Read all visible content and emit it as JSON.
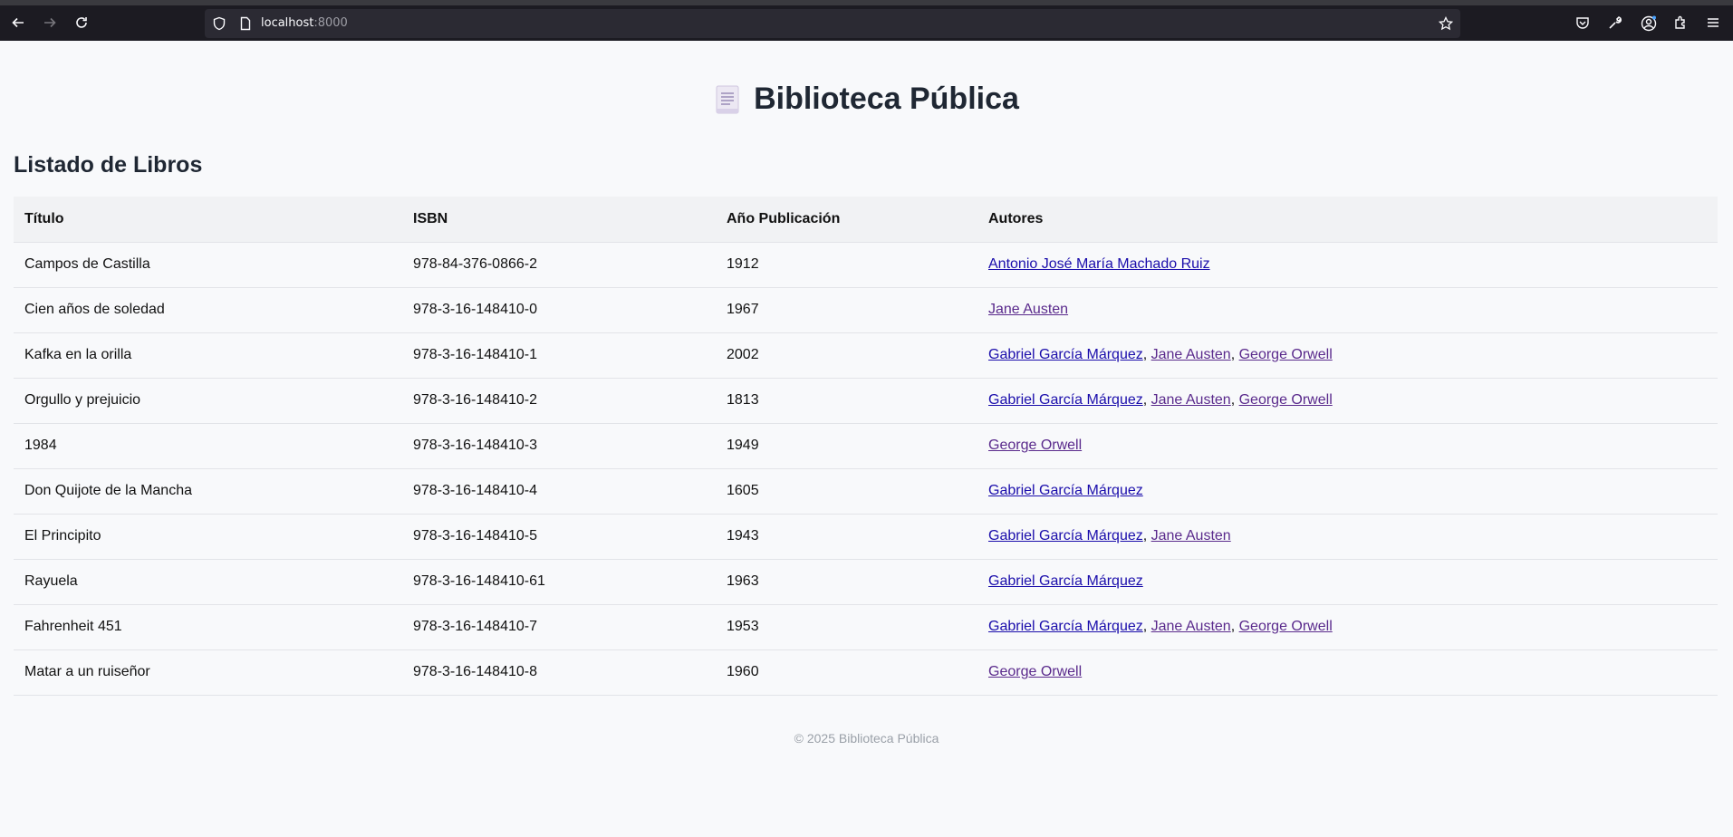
{
  "browser": {
    "url_host": "localhost",
    "url_port": ":8000"
  },
  "header": {
    "title": "Biblioteca Pública"
  },
  "section": {
    "title": "Listado de Libros"
  },
  "table": {
    "headers": [
      "Título",
      "ISBN",
      "Año Publicación",
      "Autores"
    ],
    "rows": [
      {
        "title": "Campos de Castilla",
        "isbn": "978-84-376-0866-2",
        "year": "1912",
        "authors": [
          "Antonio José María Machado Ruiz"
        ]
      },
      {
        "title": "Cien años de soledad",
        "isbn": "978-3-16-148410-0",
        "year": "1967",
        "authors": [
          "Jane Austen"
        ]
      },
      {
        "title": "Kafka en la orilla",
        "isbn": "978-3-16-148410-1",
        "year": "2002",
        "authors": [
          "Gabriel García Márquez",
          "Jane Austen",
          "George Orwell"
        ]
      },
      {
        "title": "Orgullo y prejuicio",
        "isbn": "978-3-16-148410-2",
        "year": "1813",
        "authors": [
          "Gabriel García Márquez",
          "Jane Austen",
          "George Orwell"
        ]
      },
      {
        "title": "1984",
        "isbn": "978-3-16-148410-3",
        "year": "1949",
        "authors": [
          "George Orwell"
        ]
      },
      {
        "title": "Don Quijote de la Mancha",
        "isbn": "978-3-16-148410-4",
        "year": "1605",
        "authors": [
          "Gabriel García Márquez"
        ]
      },
      {
        "title": "El Principito",
        "isbn": "978-3-16-148410-5",
        "year": "1943",
        "authors": [
          "Gabriel García Márquez",
          "Jane Austen"
        ]
      },
      {
        "title": "Rayuela",
        "isbn": "978-3-16-148410-61",
        "year": "1963",
        "authors": [
          "Gabriel García Márquez"
        ]
      },
      {
        "title": "Fahrenheit 451",
        "isbn": "978-3-16-148410-7",
        "year": "1953",
        "authors": [
          "Gabriel García Márquez",
          "Jane Austen",
          "George Orwell"
        ]
      },
      {
        "title": "Matar a un ruiseñor",
        "isbn": "978-3-16-148410-8",
        "year": "1960",
        "authors": [
          "George Orwell"
        ]
      }
    ]
  },
  "footer": {
    "text": "© 2025 Biblioteca Pública"
  },
  "colors": {
    "link": "#1a0dab",
    "visited": "#5a2a8c"
  }
}
